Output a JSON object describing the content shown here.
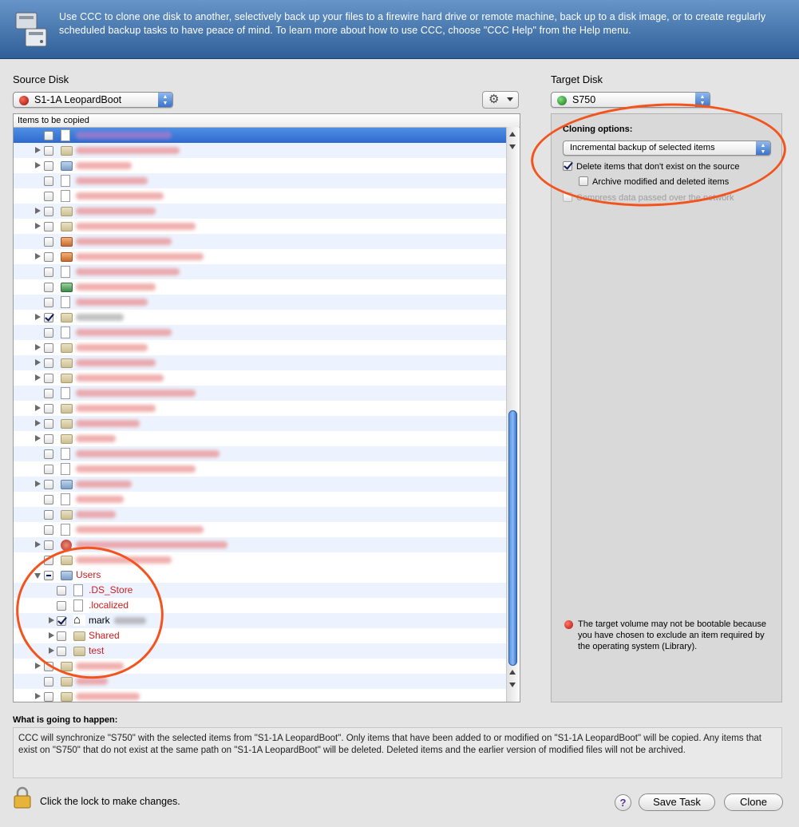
{
  "banner": {
    "text": "Use CCC to clone one disk to another, selectively back up your files to a firewire hard drive or remote machine, back up to a disk image, or to create regularly scheduled backup tasks to have peace of mind. To learn more about how to use CCC, choose \"CCC Help\" from the Help menu.",
    "icon": "ccc-disks-icon"
  },
  "source": {
    "label": "Source Disk",
    "selected": "S1-1A LeopardBoot",
    "dot_color": "#a51d12",
    "gear_icon": "gear-icon",
    "column_header": "Items to be copied"
  },
  "tree": {
    "users": {
      "label": "Users",
      "state": "mixed"
    },
    "children": [
      {
        "label": ".DS_Store",
        "checked": false
      },
      {
        "label": ".localized",
        "checked": false
      },
      {
        "label": "mark",
        "checked": true
      },
      {
        "label": "Shared",
        "checked": false
      },
      {
        "label": "test",
        "checked": false
      }
    ]
  },
  "target": {
    "label": "Target Disk",
    "selected": "S750",
    "dot_color": "#2b8a2b"
  },
  "options": {
    "title": "Cloning options:",
    "mode": "Incremental backup of selected items",
    "delete_label": "Delete items that don't exist on the source",
    "archive_label": "Archive modified and deleted items",
    "compress_label": "Compress data passed over the network",
    "warning": "The target volume may not be bootable because you have chosen to exclude an item required by the operating system (Library)."
  },
  "happen": {
    "title": "What is going to happen:",
    "text": "CCC will synchronize \"S750\" with the selected items from \"S1-1A LeopardBoot\". Only items that have been added to or modified on \"S1-1A LeopardBoot\" will be copied. Any items that exist on \"S750\" that do not exist at the same path on \"S1-1A LeopardBoot\" will be deleted. Deleted items and the earlier version of modified files will not be archived."
  },
  "footer": {
    "lock_text": "Click the lock to make changes.",
    "help_label": "?",
    "save_label": "Save Task",
    "clone_label": "Clone"
  }
}
